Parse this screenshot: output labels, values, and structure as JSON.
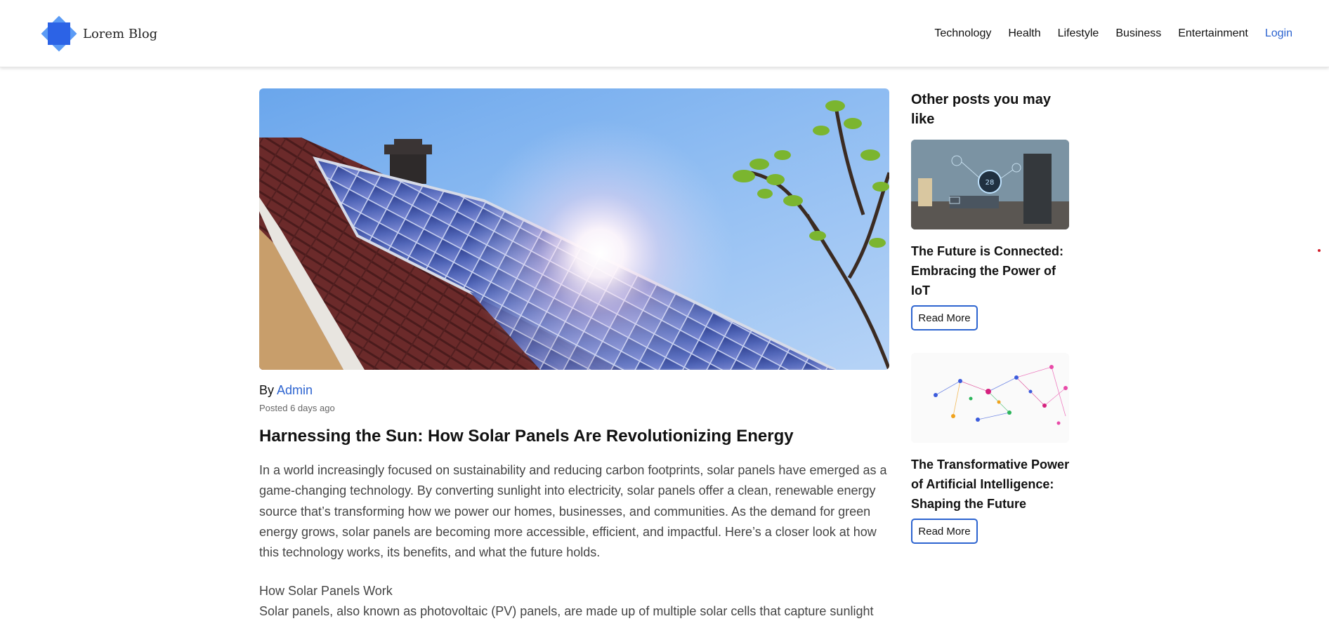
{
  "header": {
    "logo_text": "Lorem Blog",
    "nav": [
      "Technology",
      "Health",
      "Lifestyle",
      "Business",
      "Entertainment"
    ],
    "login": "Login"
  },
  "article": {
    "by": "By ",
    "author": "Admin",
    "posted": "Posted 6 days ago",
    "title": "Harnessing the Sun: How Solar Panels Are Revolutionizing Energy",
    "body": "In a world increasingly focused on sustainability and reducing carbon footprints, solar panels have emerged as a game-changing technology. By converting sunlight into electricity, solar panels offer a clean, renewable energy source that’s transforming how we power our homes, businesses, and communities. As the demand for green energy grows, solar panels are becoming more accessible, efficient, and impactful. Here’s a closer look at how this technology works, its benefits, and what the future holds.",
    "section_heading": "How Solar Panels Work",
    "section_text": "Solar panels, also known as photovoltaic (PV) panels, are made up of multiple solar cells that capture sunlight"
  },
  "sidebar": {
    "title": "Other posts you may like",
    "posts": [
      {
        "title": "The Future is Connected: Embracing the Power of IoT",
        "button": "Read More",
        "thumb_icon": "smart-home-image"
      },
      {
        "title": "The Transformative Power of Artificial Intelligence: Shaping the Future",
        "button": "Read More",
        "thumb_icon": "network-graph-image"
      }
    ]
  },
  "colors": {
    "accent": "#2d64d0",
    "logo_primary": "#2c63e6",
    "logo_secondary": "#5b9bf5"
  }
}
